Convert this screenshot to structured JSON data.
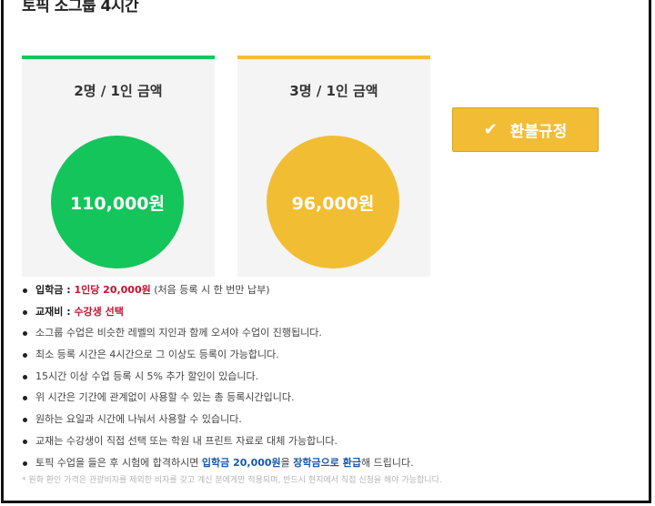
{
  "heading": "토픽 소그룹 4시간",
  "cards": [
    {
      "title": "2명 / 1인 금액",
      "price": "110,000원",
      "color": "#13c55a"
    },
    {
      "title": "3명 / 1인 금액",
      "price": "96,000원",
      "color": "#f1bd33"
    }
  ],
  "refund_button": {
    "label": "환불규정",
    "icon": "check-icon"
  },
  "info": {
    "fee_label": "입학금",
    "fee_sep": " : ",
    "fee_value": "1인당 20,000원",
    "fee_note": " (처음 등록 시 한 번만 납부)",
    "book_label": "교재비",
    "book_sep": " : ",
    "book_value": "수강생 선택",
    "lines": [
      "소그룹 수업은 비슷한 레벨의 지인과 함께 오셔야 수업이 진행됩니다.",
      "최소 등록 시간은 4시간으로 그 이상도 등록이 가능합니다.",
      "15시간 이상 수업 등록 시 5% 추가 할인이 있습니다.",
      "위 시간은 기간에 관계없이 사용할 수 있는 총 등록시간입니다.",
      "원하는 요일과 시간에 나눠서 사용할 수 있습니다.",
      "교재는 수강생이 직접 선택 또는 학원 내 프린트 자료로 대체 가능합니다."
    ],
    "scholar_pre": "토픽 수업을 들은 후 시험에 합격하시면 ",
    "scholar_amount": "입학금 20,000원",
    "scholar_mid": "을 ",
    "scholar_award": "장학금으로 환급",
    "scholar_post": "해 드립니다."
  },
  "footnote": "* 원화 환인 가격은 관광비자를 제외한 비자를 갖고 계신 분에게만 적용되며, 반드시 현지에서 직접 신청을 해야 가능합니다."
}
